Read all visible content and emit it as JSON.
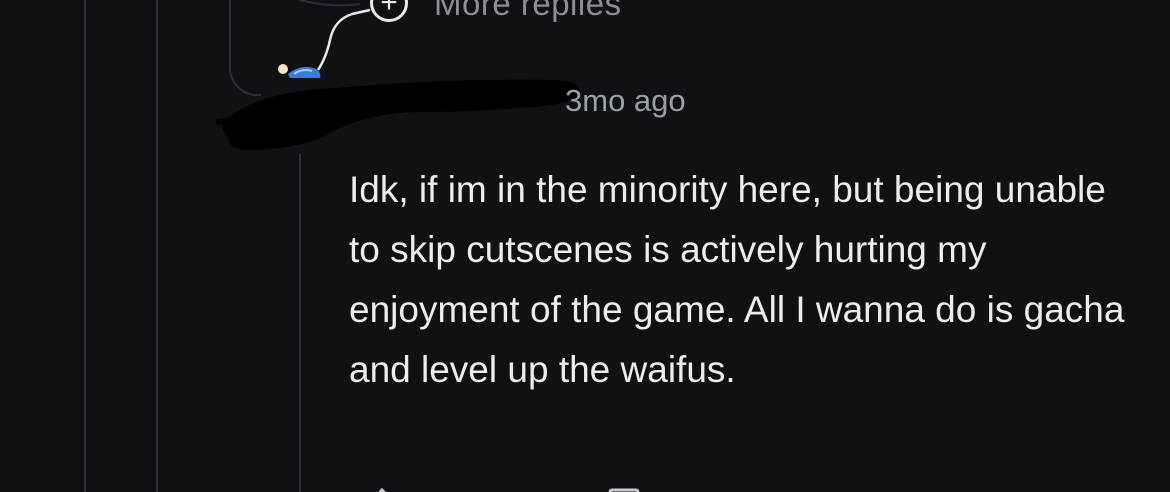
{
  "thread": {
    "more_replies_label": "More replies"
  },
  "comment": {
    "timestamp": "3mo ago",
    "body": "Idk, if im in the minority here, but being unable to skip cutscenes is actively hurting my enjoyment of the game. All I wanna do is gacha and level up the waifus."
  },
  "icons": {
    "more_replies": "plus-circle-icon",
    "avatar": "user-avatar-icon"
  },
  "colors": {
    "background": "#0f1114",
    "thread_line": "#2d3035",
    "body_text": "#ededef",
    "muted_text": "#9aa0a8",
    "redaction": "#000000"
  }
}
